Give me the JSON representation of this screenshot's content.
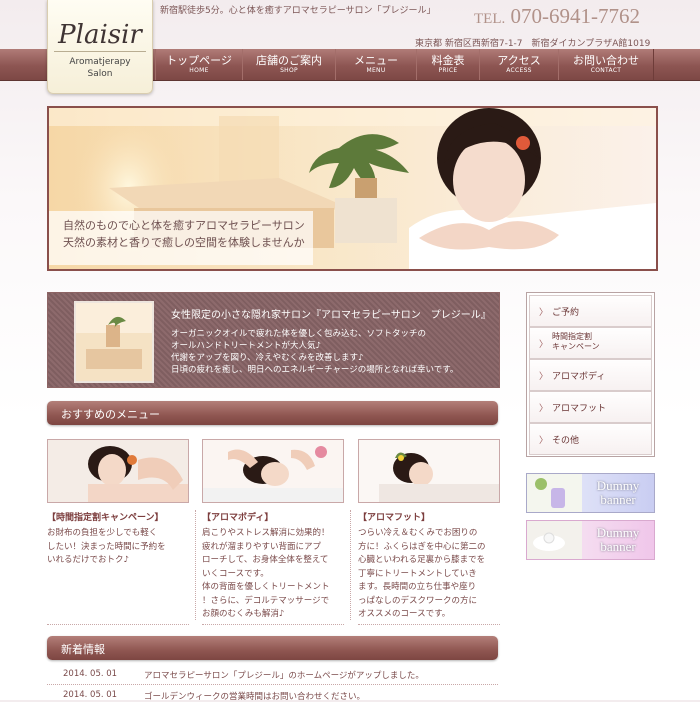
{
  "header": {
    "logo_text": "Plaisir",
    "logo_sub_1": "Aromatjerapy",
    "logo_sub_2": "Salon",
    "tagline": "新宿駅徒歩5分。心と体を癒すアロマセラピーサロン「プレジール」",
    "tel_label": "TEL.",
    "tel_number": "070-6941-7762",
    "address": "東京都 新宿区西新宿7-1-7　新宿ダイカンプラザA館1019"
  },
  "nav": [
    {
      "jp": "トップページ",
      "en": "HOME"
    },
    {
      "jp": "店舗のご案内",
      "en": "SHOP"
    },
    {
      "jp": "メニュー",
      "en": "MENU"
    },
    {
      "jp": "料金表",
      "en": "PRICE"
    },
    {
      "jp": "アクセス",
      "en": "ACCESS"
    },
    {
      "jp": "お問い合わせ",
      "en": "CONTACT"
    }
  ],
  "hero": {
    "line1": "自然のもので心と体を癒すアロマセラピーサロン",
    "line2": "天然の素材と香りで癒しの空間を体験しませんか"
  },
  "intro": {
    "title": "女性限定の小さな隠れ家サロン『アロマセラピーサロン　プレジール』",
    "lines": [
      "オーガニックオイルで疲れた体を優しく包み込む、ソフトタッチの",
      "オールハンドトリートメントが大人気♪",
      "代謝をアップを図り、冷えやむくみを改善します♪",
      "日頃の疲れを癒し、明日へのエネルギーチャージの場所となれば幸いです。"
    ]
  },
  "menu_section": {
    "heading": "おすすめのメニュー",
    "cards": [
      {
        "title": "【時間指定割キャンペーン】",
        "lines": [
          "お財布の負担を少しでも軽く",
          "したい！決まった時間に予約を",
          "いれるだけでおトク♪"
        ]
      },
      {
        "title": "【アロマボディ】",
        "lines": [
          "肩こりやストレス解消に効果的！",
          "疲れが溜まりやすい背面にアプ",
          "ローチして、お身体全体を整えて",
          "いくコースです。",
          "体の背面を優しくトリートメント",
          "！さらに、デコルテマッサージで",
          "お顔のむくみも解消♪"
        ]
      },
      {
        "title": "【アロマフット】",
        "lines": [
          "つらい冷え＆むくみでお困りの",
          "方に！ふくらはぎを中心に第二の",
          "心臓といわれる足裏から膝までを",
          "丁寧にトリートメントしていき",
          "ます。長時間の立ち仕事や座り",
          "っぱなしのデスクワークの方に",
          "オススメのコースです。"
        ]
      }
    ]
  },
  "news": {
    "heading": "新着情報",
    "items": [
      {
        "date": "2014. 05. 01",
        "text": "アロマセラピーサロン「プレジール」のホームページがアップしました。"
      },
      {
        "date": "2014. 05. 01",
        "text": "ゴールデンウィークの営業時間はお問い合わせください。"
      }
    ]
  },
  "side_menu": [
    {
      "label": "ご予約"
    },
    {
      "label": "時間指定割\nキャンペーン"
    },
    {
      "label": "アロマボディ"
    },
    {
      "label": "アロマフット"
    },
    {
      "label": "その他"
    }
  ],
  "banners": [
    {
      "label1": "Dummy",
      "label2": "banner",
      "color": "#c9cdf2"
    },
    {
      "label1": "Dummy",
      "label2": "banner",
      "color": "#f0c6ea"
    }
  ],
  "colors": {
    "accent": "#8f5651",
    "tel": "#b1928a",
    "text": "#7a4a4a"
  }
}
